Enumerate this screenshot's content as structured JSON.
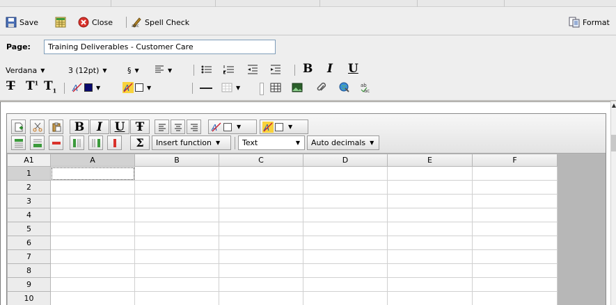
{
  "toolbar": {
    "save_label": "Save",
    "close_label": "Close",
    "spell_check_label": "Spell Check",
    "format_label": "Format"
  },
  "page": {
    "label": "Page:",
    "value": "Training Deliverables - Customer Care"
  },
  "formatting": {
    "font_family": "Verdana",
    "font_size": "3 (12pt)",
    "section_symbol": "§",
    "bold_glyph": "B",
    "italic_glyph": "I",
    "underline_glyph": "U",
    "text_color": "#0a0a6e",
    "highlight_color": "#ffffff"
  },
  "spreadsheet": {
    "insert_function_label": "Insert function",
    "format_select_value": "Text",
    "decimals_select_value": "Auto decimals",
    "sum_glyph": "Σ",
    "bold_glyph": "B",
    "italic_glyph": "I",
    "underline_glyph": "U",
    "strike_glyph": "Ŧ",
    "cell_ref": "A1",
    "columns": [
      "A",
      "B",
      "C",
      "D",
      "E",
      "F"
    ],
    "rows": [
      "1",
      "2",
      "3",
      "4",
      "5",
      "6",
      "7",
      "8",
      "9",
      "10"
    ]
  }
}
